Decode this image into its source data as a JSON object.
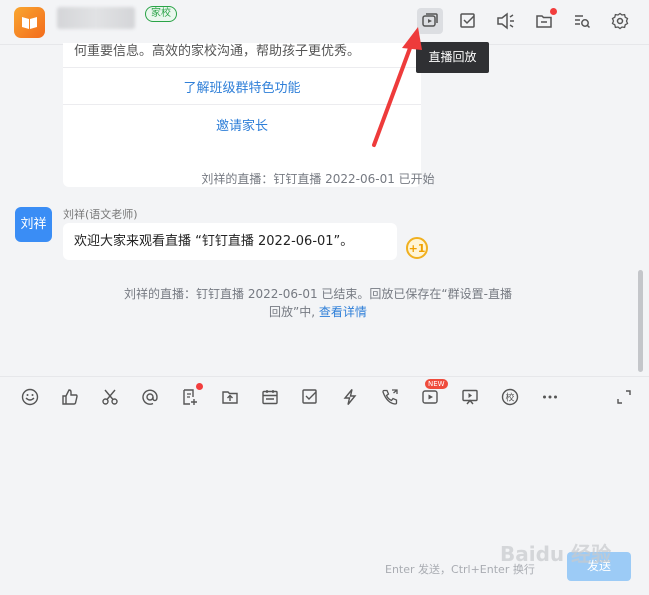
{
  "header": {
    "badge": "家校",
    "tooltip": "直播回放",
    "buttons": [
      "live-replay-icon",
      "task-check-icon",
      "announcement-icon",
      "file-icon",
      "search-history-icon",
      "settings-icon"
    ]
  },
  "card": {
    "text": "何重要信息。高效的家校沟通，帮助孩子更优秀。",
    "link1": "了解班级群特色功能",
    "link2": "邀请家长"
  },
  "chat": {
    "system_start": "刘祥的直播：钉钉直播 2022-06-01 已开始",
    "avatar_text": "刘祥",
    "sender": "刘祥(语文老师)",
    "message": "欢迎大家来观看直播 “钉钉直播 2022-06-01”。",
    "plus_one": "+1",
    "system_end_line1": "刘祥的直播：钉钉直播 2022-06-01 已结束。回放已保存在“群设置-直播",
    "system_end_line2": "回放”中,",
    "system_end_link": "查看详情"
  },
  "toolbar": {
    "tools": [
      "emoji-icon",
      "thumbs-up-icon",
      "scissors-icon",
      "mention-icon",
      "doc-add-icon",
      "upload-icon",
      "calendar-icon",
      "todo-icon",
      "flash-icon",
      "call-icon",
      "live-icon",
      "whiteboard-icon",
      "school-icon",
      "more-icon"
    ],
    "new_badge": "NEW"
  },
  "input": {
    "hint": "Enter 发送，Ctrl+Enter 换行",
    "send": "发送"
  },
  "watermark": "Baidu 经验",
  "colors": {
    "accent": "#2f7fd8",
    "avatar": "#3a8df5",
    "annotation": "#ee3b3b"
  }
}
